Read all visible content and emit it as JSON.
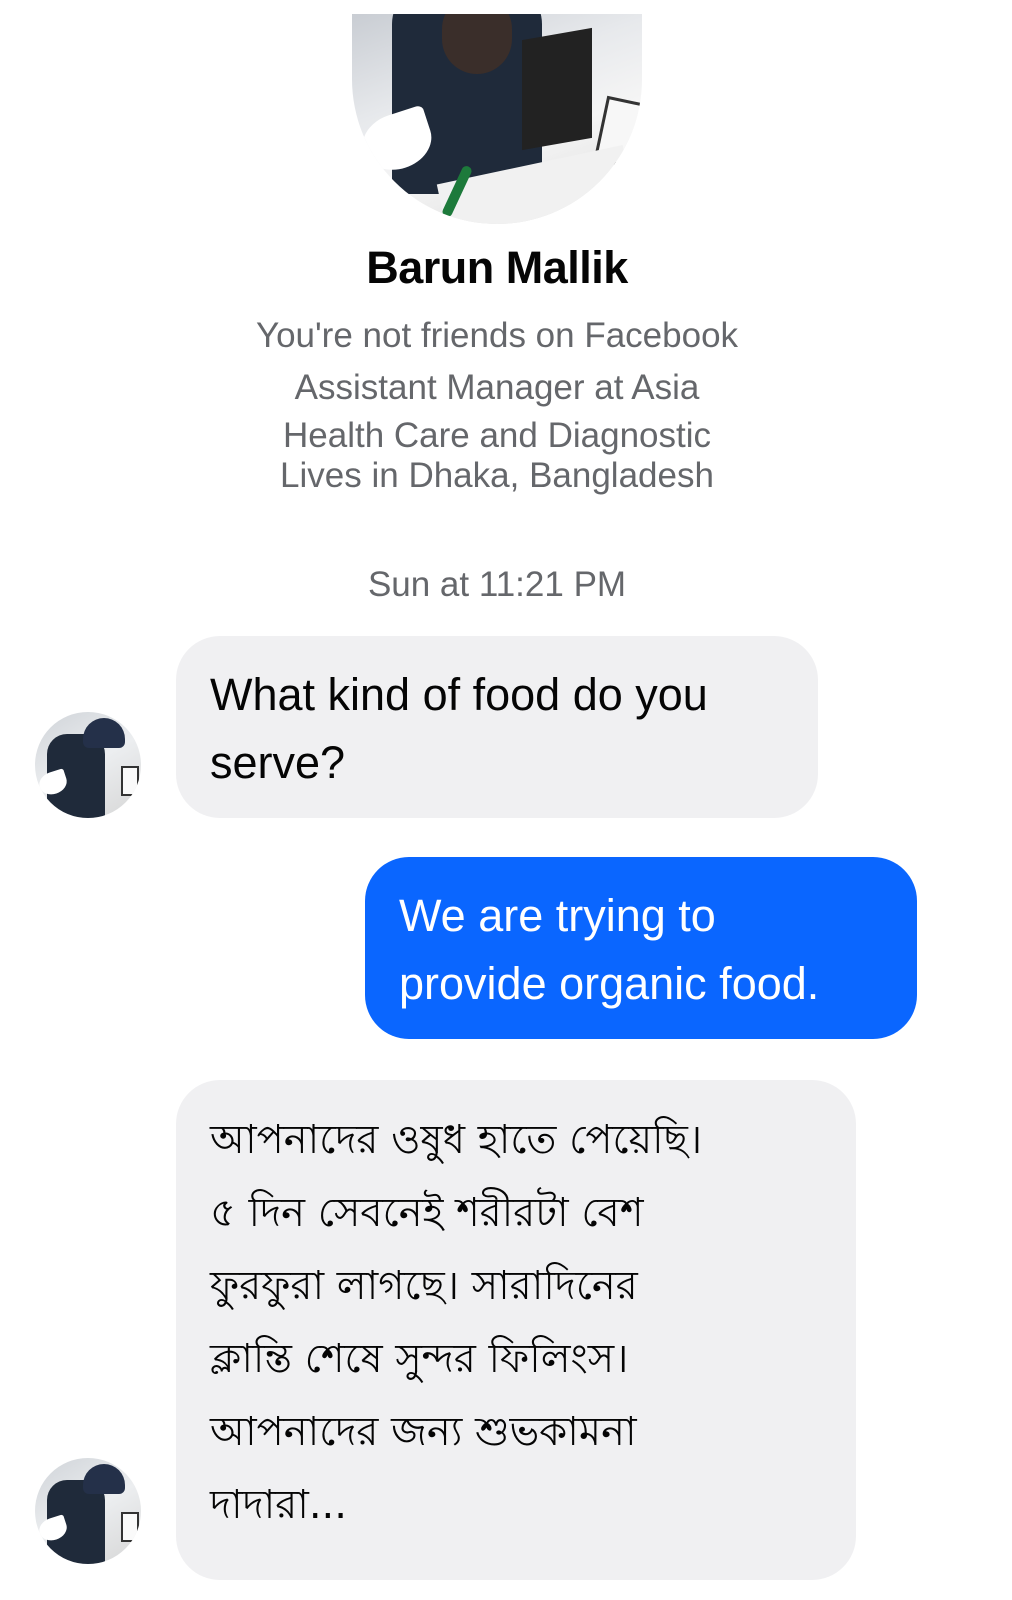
{
  "profile": {
    "name": "Barun Mallik",
    "friend_status": "You're not friends on Facebook",
    "work_line_1": "Assistant Manager at Asia",
    "work_line_2": "Health Care and Diagnostic",
    "location": "Lives in Dhaka, Bangladesh"
  },
  "conversation": {
    "timestamp": "Sun at 11:21 PM",
    "messages": [
      {
        "direction": "incoming",
        "text": "What kind of food do you\nserve?"
      },
      {
        "direction": "outgoing",
        "text": "We are trying to\nprovide organic food."
      },
      {
        "direction": "incoming",
        "text": "আপনাদের ওষুধ হাতে পেয়েছি।\n৫ দিন সেবনেই শরীরটা বেশ\nফুরফুরা লাগছে। সারাদিনের\nক্লান্তি শেষে সুন্দর ফিলিংস।\nআপনাদের জন্য শুভকামনা\nদাদারা..."
      }
    ]
  },
  "colors": {
    "outgoing_bubble": "#0a66ff",
    "incoming_bubble": "#f0f0f2",
    "secondary_text": "#65676b"
  }
}
